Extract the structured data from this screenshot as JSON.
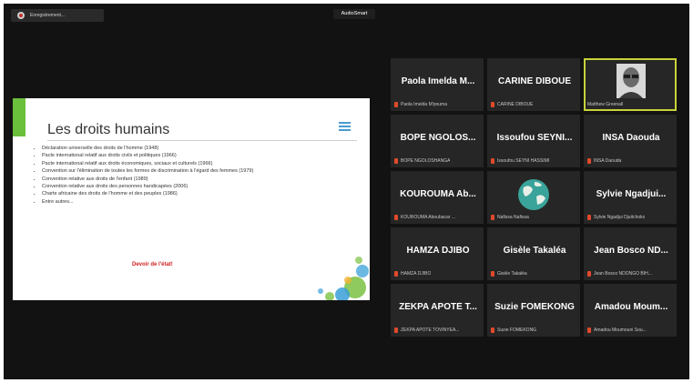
{
  "recording": {
    "label": "Enregistrement..."
  },
  "window": {
    "title": "AudioSmart"
  },
  "slide": {
    "title": "Les droits humains",
    "bullets": [
      "Déclaration universelle des droits de l'homme (1948)",
      "Pacte international relatif aux droits civils et politiques (1966)",
      "Pacte international relatif aux droits économiques, sociaux et culturels (1966)",
      "Convention sur l'élimination de toutes les formes de discrimination à l'égard des femmes (1979)",
      "Convention relative aux droits de l'enfant (1989)",
      "Convention relative aux droits des personnes handicapées (2006)",
      "Charte africaine des droits de l'homme et des peuples (1986)",
      "Entre autres..."
    ],
    "callout": "Devoir de l'état!"
  },
  "participants": [
    {
      "name": "Paola Imelda M...",
      "caption": "Paola Imelda M'pouma"
    },
    {
      "name": "CARINE DIBOUE",
      "caption": "CARINE DIBOUE"
    },
    {
      "name": "",
      "caption": "Matthew Greenall",
      "video": "photo"
    },
    {
      "name": "BOPE NGOLOS...",
      "caption": "BOPE NGOLOSHANGA"
    },
    {
      "name": "Issoufou SEYNI...",
      "caption": "Issoufou SEYNI HASSIMI"
    },
    {
      "name": "INSA Daouda",
      "caption": "INSA Daouda"
    },
    {
      "name": "KOUROUMA Ab...",
      "caption": "KOUROUMA Aboubacar ..."
    },
    {
      "name": "",
      "caption": "Nafissa Nafissa",
      "video": "globe"
    },
    {
      "name": "Sylvie Ngadjui...",
      "caption": "Sylvie Ngadjui Djuitchoko"
    },
    {
      "name": "HAMZA DJIBO",
      "caption": "HAMZA DJIBO"
    },
    {
      "name": "Gisèle Takaléa",
      "caption": "Gisèle Takaléa"
    },
    {
      "name": "Jean Bosco ND...",
      "caption": "Jean Bosco NDONGO BIH..."
    },
    {
      "name": "ZEKPA APOTÉ T...",
      "caption": "ZEKPA APOTÉ TOVINYÉA..."
    },
    {
      "name": "Suzie FOMEKONG",
      "caption": "Suzie FOMEKONG"
    },
    {
      "name": "Amadou Moum...",
      "caption": "Amadou Moumouni Sou..."
    }
  ],
  "colors": {
    "accent": "#6abf3b",
    "active_speaker": "#c8d23a",
    "mic_muted": "#e04a2a",
    "callout": "#d02020"
  }
}
